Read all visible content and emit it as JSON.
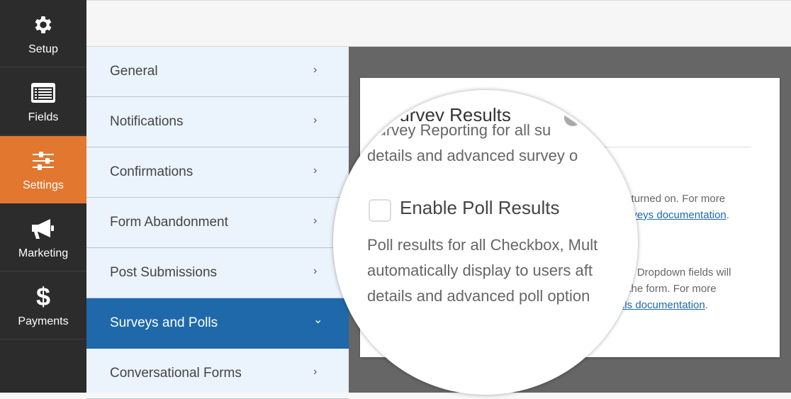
{
  "sidebar": {
    "items": [
      {
        "label": "Setup",
        "icon": "gear-icon",
        "active": false
      },
      {
        "label": "Fields",
        "icon": "list-icon",
        "active": false
      },
      {
        "label": "Settings",
        "icon": "sliders-icon",
        "active": true
      },
      {
        "label": "Marketing",
        "icon": "megaphone-icon",
        "active": false
      },
      {
        "label": "Payments",
        "icon": "dollar-icon",
        "active": false
      }
    ]
  },
  "settings_nav": {
    "items": [
      {
        "label": "General",
        "chevron": "›"
      },
      {
        "label": "Notifications",
        "chevron": "›"
      },
      {
        "label": "Confirmations",
        "chevron": "›"
      },
      {
        "label": "Form Abandonment",
        "chevron": "›"
      },
      {
        "label": "Post Submissions",
        "chevron": "›"
      },
      {
        "label": "Surveys and Polls",
        "chevron": "⌄",
        "active": true
      },
      {
        "label": "Conversational Forms",
        "chevron": "›"
      }
    ]
  },
  "card": {
    "survey_desc_line1_tail": "e turned on. For more",
    "survey_link_fragment": "urveys documentation",
    "survey_link_suffix": ".",
    "poll_desc_line1_tail": "nd Dropdown fields will",
    "poll_desc_line2_tail": "t the form. For more",
    "poll_link_fragment": "ils documentation",
    "poll_link_suffix": "."
  },
  "magnifier": {
    "section_title": "Survey Results",
    "help_icon": "?",
    "survey_line1": "Survey Reporting for all su",
    "survey_line2": "details and advanced survey o",
    "checkbox_label": "Enable Poll Results",
    "checkbox_checked": false,
    "poll_line1": "Poll results for all Checkbox, Mult",
    "poll_line2": "automatically display to users aft",
    "poll_line3": "details and advanced poll option"
  },
  "colors": {
    "accent_orange": "#e27730",
    "active_blue": "#1f69ab",
    "sidebar_dark": "#2c2c2c",
    "nav_bg": "#ebf3fc"
  }
}
